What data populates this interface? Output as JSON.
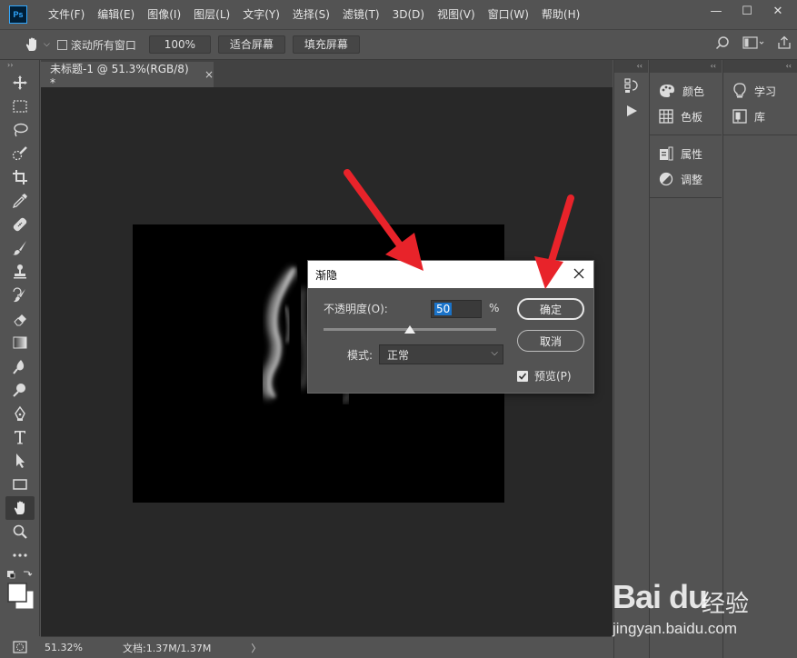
{
  "app": {
    "logo": "Ps"
  },
  "menu": [
    "文件(F)",
    "编辑(E)",
    "图像(I)",
    "图层(L)",
    "文字(Y)",
    "选择(S)",
    "滤镜(T)",
    "3D(D)",
    "视图(V)",
    "窗口(W)",
    "帮助(H)"
  ],
  "window_controls": {
    "minimize": "—",
    "maximize": "☐",
    "close": "✕"
  },
  "options_bar": {
    "scroll_all_label": "滚动所有窗口",
    "zoom_value": "100%",
    "fit_screen": "适合屏幕",
    "fill_screen": "填充屏幕"
  },
  "tools": [
    "move-tool",
    "marquee-tool",
    "lasso-tool",
    "quick-select-tool",
    "crop-tool",
    "eyedropper-tool",
    "healing-brush-tool",
    "brush-tool",
    "stamp-tool",
    "history-brush-tool",
    "eraser-tool",
    "gradient-tool",
    "blur-tool",
    "dodge-tool",
    "pen-tool",
    "type-tool",
    "path-select-tool",
    "rectangle-tool",
    "hand-tool",
    "zoom-tool",
    "more-tools"
  ],
  "document": {
    "tab_title": "未标题-1 @ 51.3%(RGB/8) *",
    "tab_close": "×"
  },
  "status": {
    "zoom": "51.32%",
    "doc_info": "文档:1.37M/1.37M",
    "arrow": "〉"
  },
  "panels": {
    "col1_group1": [
      {
        "icon": "palette-icon",
        "label": "颜色"
      },
      {
        "icon": "grid-icon",
        "label": "色板"
      }
    ],
    "col1_group2": [
      {
        "icon": "properties-icon",
        "label": "属性"
      },
      {
        "icon": "adjust-icon",
        "label": "调整"
      }
    ],
    "col2": [
      {
        "icon": "lightbulb-icon",
        "label": "学习"
      },
      {
        "icon": "library-icon",
        "label": "库"
      }
    ]
  },
  "dialog": {
    "title": "渐隐",
    "opacity_label": "不透明度(O):",
    "opacity_value": "50",
    "opacity_unit": "%",
    "opacity_fraction": 0.5,
    "mode_label": "模式:",
    "mode_value": "正常",
    "ok_label": "确定",
    "cancel_label": "取消",
    "preview_label": "预览(P)",
    "preview_checked": true
  },
  "watermark": {
    "logo": "Bai du",
    "brand": "经验",
    "url": "jingyan.baidu.com"
  },
  "colors": {
    "ui_bg": "#535353",
    "canvas_bg": "#282828",
    "accent_arrow": "#e8232a",
    "selection": "#1a73c9"
  }
}
